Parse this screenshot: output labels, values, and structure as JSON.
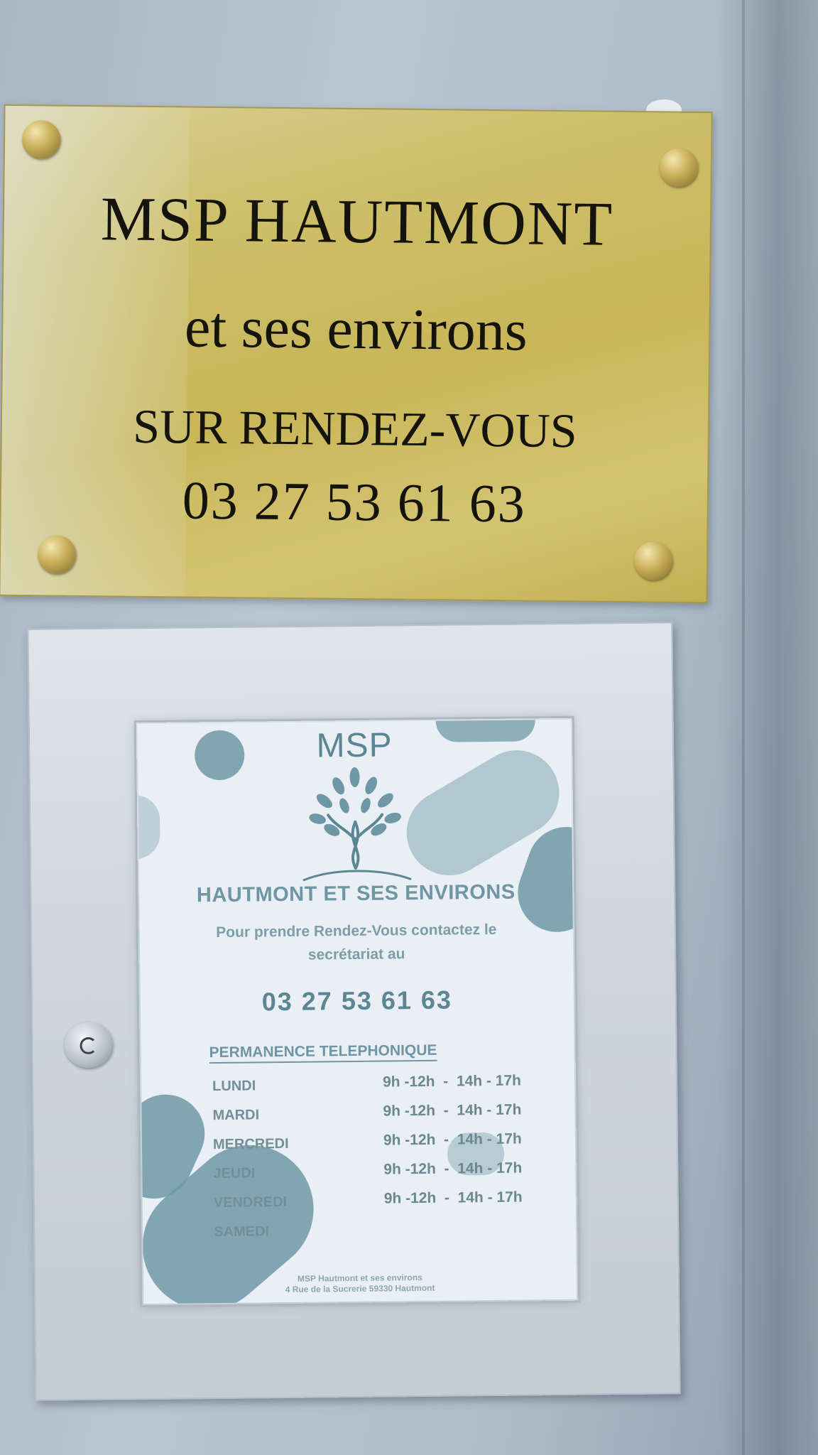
{
  "plaque": {
    "title": "MSP HAUTMONT",
    "subtitle": "et ses environs",
    "appointment": "SUR RENDEZ-VOUS",
    "phone": "03 27 53 61 63"
  },
  "poster": {
    "brand": "MSP",
    "organization": "HAUTMONT ET SES ENVIRONS",
    "contact_line1": "Pour prendre Rendez-Vous  contactez le",
    "contact_line2": "secrétariat au",
    "phone": "03 27 53 61 63",
    "schedule_heading": "PERMANENCE TELEPHONIQUE",
    "schedule": [
      {
        "day": "LUNDI",
        "hours": "9h -12h  -  14h - 17h"
      },
      {
        "day": "MARDI",
        "hours": "9h -12h  -  14h - 17h"
      },
      {
        "day": "MERCREDI",
        "hours": "9h -12h  -  14h - 17h"
      },
      {
        "day": "JEUDI",
        "hours": "9h -12h  -  14h - 17h"
      },
      {
        "day": "VENDREDI",
        "hours": "9h -12h  -  14h - 17h"
      },
      {
        "day": "SAMEDI",
        "hours": ""
      }
    ],
    "footer_line1": "MSP Hautmont et ses environs",
    "footer_line2": "4 Rue de la Sucrerie 59330 Hautmont"
  },
  "colors": {
    "wall": "#b3c0cc",
    "brass": "#cdbf6a",
    "frame": "#d3dae0",
    "poster_accent": "#6f98a6"
  }
}
